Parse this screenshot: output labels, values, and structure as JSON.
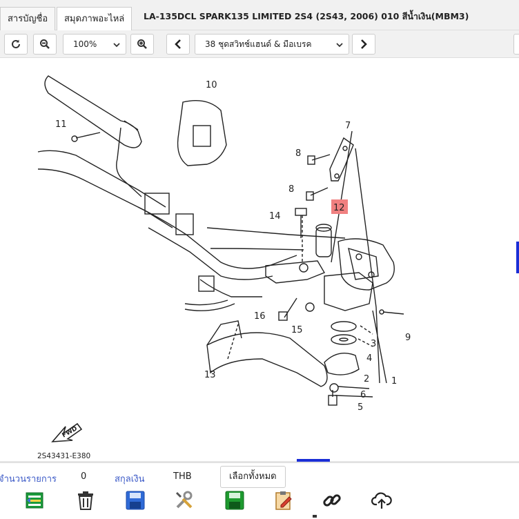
{
  "tabs": [
    {
      "label": "สารบัญชื่อ"
    },
    {
      "label": "สมุดภาพอะไหล่"
    }
  ],
  "title": "LA-135DCL SPARK135 LIMITED 2S4 (2S43, 2006) 010 สีน้ำเงิน(MBM3)",
  "toolbar": {
    "zoom": "100%",
    "page_select": "38 ชุดสวิทช์แฮนด์ & มือเบรค",
    "refresh_icon": "refresh-icon",
    "zoom_out_icon": "zoom-out-icon",
    "zoom_in_icon": "zoom-in-icon",
    "prev_icon": "chevron-left-icon",
    "next_icon": "chevron-right-icon"
  },
  "diagram": {
    "callouts": [
      "1",
      "2",
      "3",
      "4",
      "5",
      "6",
      "7",
      "8",
      "8",
      "9",
      "10",
      "11",
      "12",
      "13",
      "14",
      "15",
      "16"
    ],
    "highlighted_callout": "12",
    "highlight_color": "#f08080",
    "fwd_label": "FWD",
    "figure_code": "2S43431-E380"
  },
  "footer": {
    "count_label": "จำนวนรายการ",
    "count_value": "0",
    "currency_label": "สกุลเงิน",
    "currency_value": "THB",
    "select_all": "เลือกทั้งหมด",
    "icons": [
      "list-icon",
      "trash-icon",
      "save-blue-icon",
      "tools-icon",
      "save-green-icon",
      "clipboard-edit-icon",
      "link-icon",
      "upload-cloud-icon"
    ]
  },
  "colors": {
    "accent": "#1a2ed6",
    "label_blue": "#3c5ac7"
  }
}
